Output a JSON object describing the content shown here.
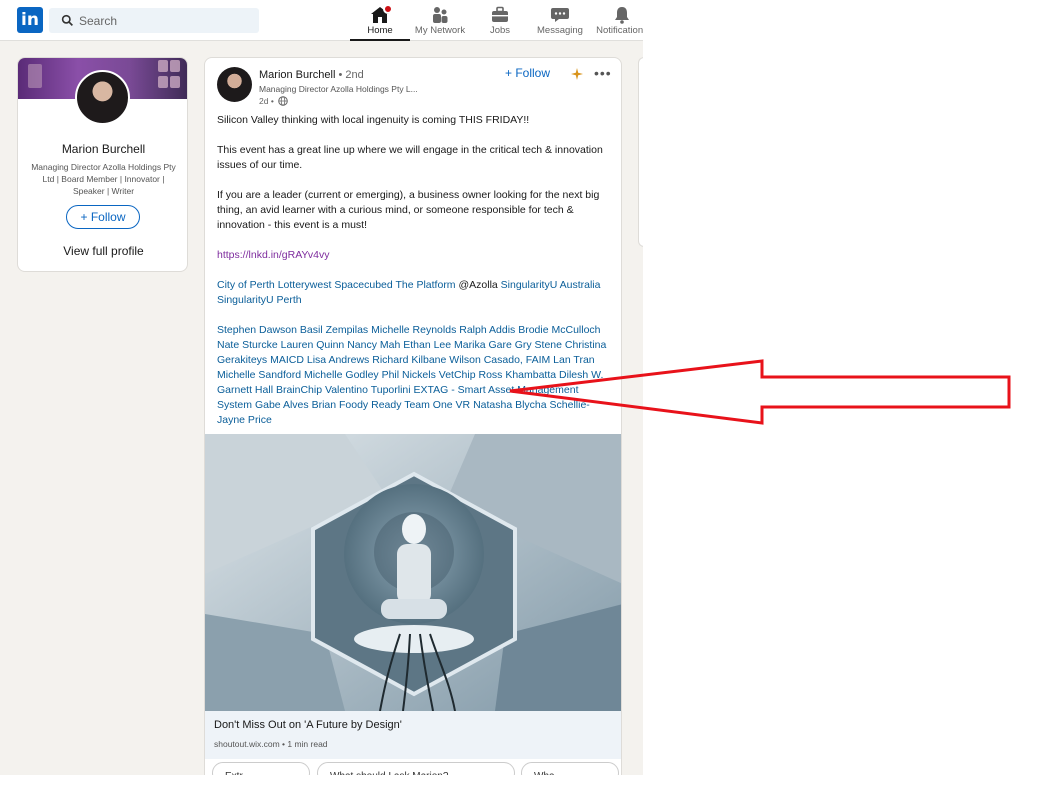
{
  "nav": {
    "logo": "in",
    "search_placeholder": "Search",
    "items": [
      {
        "label": "Home",
        "icon": "home-icon",
        "active": true
      },
      {
        "label": "My Network",
        "icon": "network-icon"
      },
      {
        "label": "Jobs",
        "icon": "briefcase-icon"
      },
      {
        "label": "Messaging",
        "icon": "chat-icon"
      },
      {
        "label": "Notifications",
        "icon": "bell-icon"
      }
    ]
  },
  "profile": {
    "name": "Marion Burchell",
    "headline": "Managing Director Azolla Holdings Pty Ltd | Board Member | Innovator | Speaker | Writer",
    "follow": "+ Follow",
    "view": "View full profile"
  },
  "post": {
    "author": "Marion Burchell",
    "degree": "• 2nd",
    "headline": "Managing Director Azolla Holdings Pty L...",
    "time": "2d •",
    "follow": "+ Follow",
    "more": "•••",
    "p1": "Silicon Valley thinking with local ingenuity is coming THIS FRIDAY!!",
    "p2": "This event has a great line up where we will engage in the critical tech & innovation issues of our time.",
    "p3": "If you are a leader (current or emerging), a business owner looking for the next big thing, an avid learner with a curious mind, or someone responsible for tech & innovation - this event is a must!",
    "link": "https://lnkd.in/gRAYv4vy",
    "org_tags": [
      "City of Perth",
      "Lotterywest",
      "Spacecubed",
      "The Platform"
    ],
    "org_plain": "@Azolla",
    "org_tags2": [
      "SingularityU Australia",
      "SingularityU Perth"
    ],
    "people": [
      "Stephen Dawson",
      "Basil Zempilas",
      "Michelle Reynolds",
      "Ralph Addis",
      "Brodie McCulloch",
      "Nate Sturcke",
      "Lauren Quinn",
      "Nancy Mah",
      "Ethan Lee",
      "Marika Gare",
      "Gry Stene",
      "Christina Gerakiteys MAICD",
      "Lisa Andrews",
      "Richard Kilbane",
      "Wilson Casado, FAIM",
      "Lan Tran",
      "Michelle Sandford",
      "Michelle Godley",
      "Phil Nickels",
      "VetChip",
      "Ross Khambatta",
      "Dilesh W.",
      "Garnett Hall"
    ],
    "brainchip": "BrainChip",
    "people2": [
      "Valentino Tuporlini",
      "EXTAG - Smart Asset Management System",
      "Gabe Alves",
      "Brian Foody",
      "Ready Team One VR",
      "Natasha Blycha",
      "Schellie-Jayne Price"
    ],
    "card_title": "Don't Miss Out on 'A Future by Design'",
    "card_meta": "shoutout.wix.com • 1 min read"
  },
  "chips": [
    "Extr",
    "What should I ask Marion?",
    "Wha"
  ],
  "colors": {
    "brand": "#0a66c2",
    "arrow": "#e8121a",
    "visited_link": "#7e2c9e"
  }
}
